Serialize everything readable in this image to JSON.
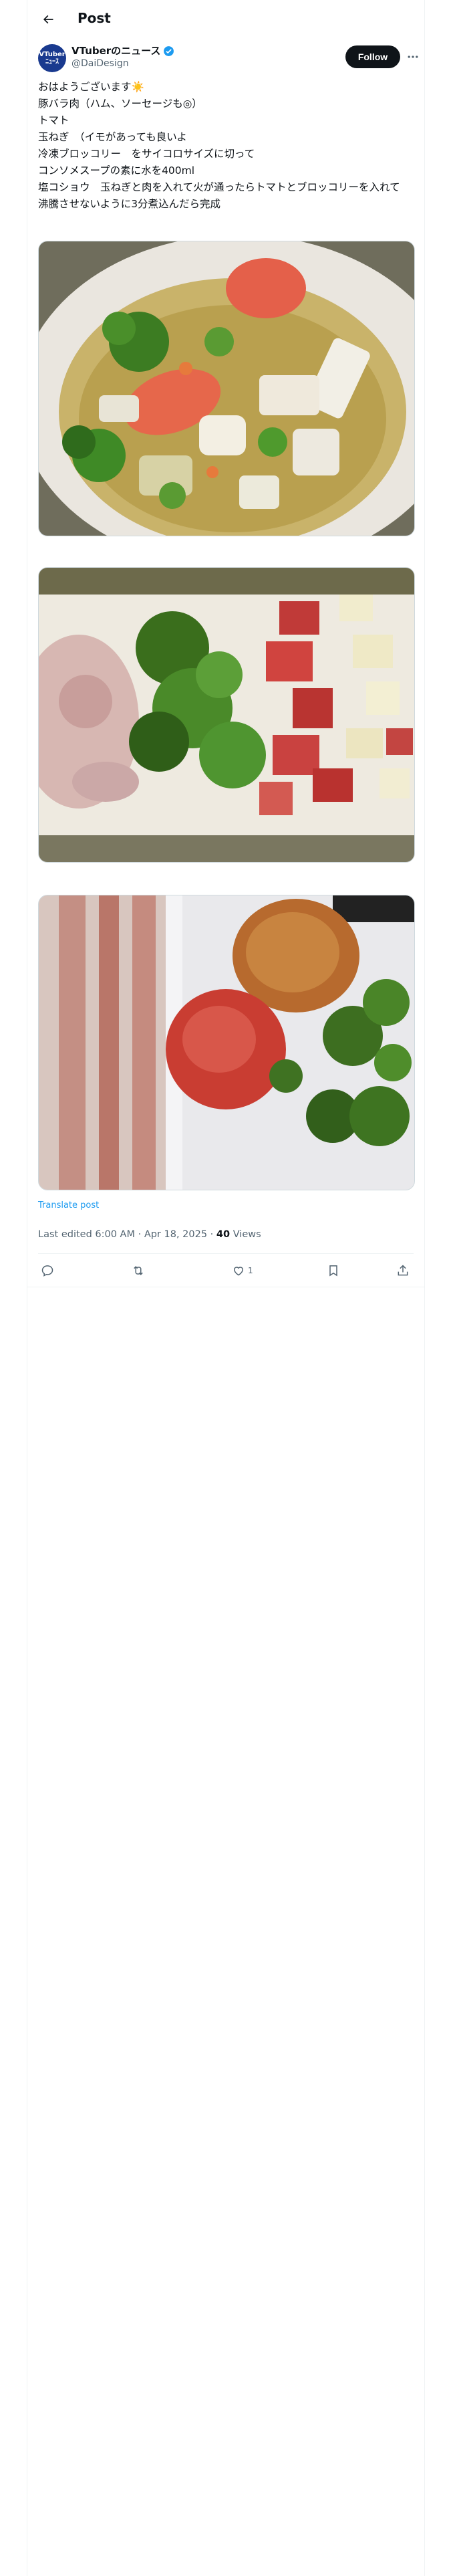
{
  "header": {
    "title": "Post"
  },
  "author": {
    "name": "VTuberのニュース",
    "handle": "@DaiDesign",
    "avatar_text": "VTuber\nﾆｭｰｽ",
    "follow_label": "Follow",
    "verified_color": "#1d9bf0"
  },
  "post": {
    "lines": [
      "おはようございます☀️",
      "豚バラ肉（ハム、ソーセージも◎）",
      "トマト",
      "玉ねぎ　（イモがあっても良いよ",
      "冷凍ブロッコリー　をサイコロサイズに切って",
      "コンソメスープの素に水を400ml",
      "塩コショウ　玉ねぎと肉を入れて火が通ったらトマトとブロッコリーを入れて",
      "沸騰させないように3分煮込んだら完成"
    ]
  },
  "images": [
    {
      "alt": "soup-with-broccoli-tomato-pork"
    },
    {
      "alt": "chopped-pork-broccoli-tomato-onion"
    },
    {
      "alt": "raw-bacon-tomato-onion-broccoli"
    }
  ],
  "translate_label": "Translate post",
  "meta": {
    "edited": "Last edited 6:00 AM · Apr 18, 2025 · ",
    "views_count": "40",
    "views_label": " Views"
  },
  "actions": {
    "reply_count": "",
    "repost_count": "",
    "like_count": "1",
    "bookmark_count": ""
  },
  "colors": {
    "accent": "#1d9bf0",
    "text": "#0f1419",
    "secondary": "#536471"
  }
}
